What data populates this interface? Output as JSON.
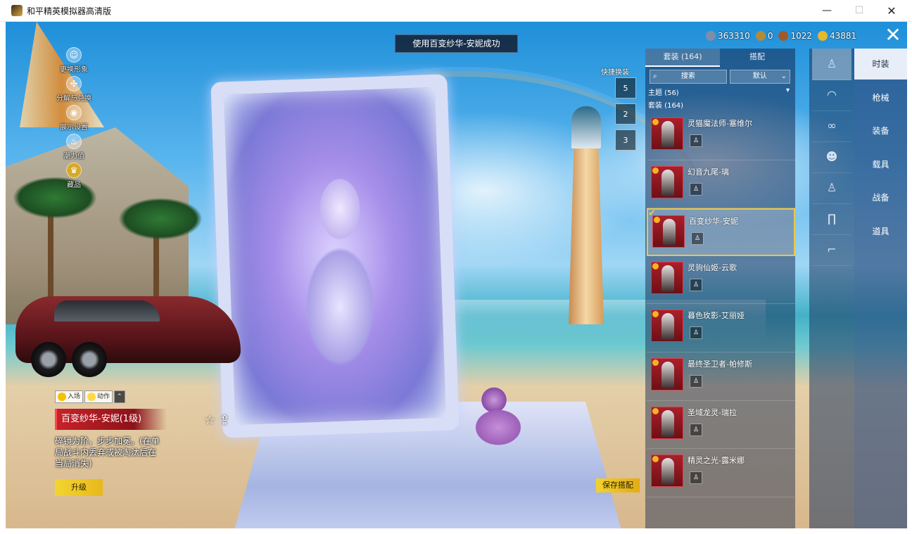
{
  "window": {
    "title": "和平精英模拟器高清版",
    "min_glyph": "—",
    "max_glyph": "☐",
    "close_glyph": "✕"
  },
  "toast": "使用百变纱华-安妮成功",
  "currencies": [
    {
      "icon": "gem-icon",
      "value": "363310",
      "color": "#7f8ea8"
    },
    {
      "icon": "coin-icon",
      "value": "0",
      "color": "#b08b3a"
    },
    {
      "icon": "token-icon",
      "value": "1022",
      "color": "#a05a2a"
    },
    {
      "icon": "gold-coin-icon",
      "value": "43881",
      "color": "#e6b82a"
    }
  ],
  "left_menu": [
    {
      "label": "更换形象",
      "icon": "person-icon",
      "glyph": "☺"
    },
    {
      "label": "分解与兑换",
      "icon": "swap-icon",
      "glyph": "✣"
    },
    {
      "label": "展示设置",
      "icon": "eye-icon",
      "glyph": "◉"
    },
    {
      "label": "潮力值",
      "icon": "flame-icon",
      "glyph": "♨"
    },
    {
      "label": "藏品",
      "icon": "crown-icon",
      "glyph": "♛"
    }
  ],
  "quick_swap": {
    "label": "快捷换装",
    "slots": [
      "5",
      "2",
      "3"
    ]
  },
  "panel": {
    "tabs": [
      "套装 (164)",
      "搭配"
    ],
    "search_placeholder": "搜索",
    "sort_label": "默认",
    "theme_label": "主题 (56)",
    "set_label": "套装 (164)",
    "items": [
      {
        "name": "灵猫魔法师-塞维尔",
        "selected": false
      },
      {
        "name": "幻音九尾-璃",
        "selected": false
      },
      {
        "name": "百变纱华-安妮",
        "selected": true
      },
      {
        "name": "灵驹仙姬-云歌",
        "selected": false
      },
      {
        "name": "暮色玫影-艾丽娅",
        "selected": false
      },
      {
        "name": "最终圣卫者-帕修斯",
        "selected": false
      },
      {
        "name": "圣域龙灵-瑞拉",
        "selected": false
      },
      {
        "name": "精灵之光-露米娜",
        "selected": false
      }
    ]
  },
  "category_icons": [
    {
      "icon": "outfit-icon",
      "glyph": "♙",
      "active": true
    },
    {
      "icon": "hat-icon",
      "glyph": "◠",
      "active": false
    },
    {
      "icon": "glasses-icon",
      "glyph": "∞",
      "active": false
    },
    {
      "icon": "face-icon",
      "glyph": "☻",
      "active": false
    },
    {
      "icon": "top-icon",
      "glyph": "♙",
      "active": false
    },
    {
      "icon": "pants-icon",
      "glyph": "∏",
      "active": false
    },
    {
      "icon": "shoes-icon",
      "glyph": "⌐",
      "active": false
    }
  ],
  "category_tabs": [
    {
      "label": "时装",
      "active": true
    },
    {
      "label": "枪械",
      "active": false
    },
    {
      "label": "装备",
      "active": false
    },
    {
      "label": "载具",
      "active": false
    },
    {
      "label": "战备",
      "active": false
    },
    {
      "label": "道具",
      "active": false
    }
  ],
  "bottom_left": {
    "entrance_label": "入场",
    "action_label": "动作",
    "item_name": "百变纱华-安妮(1级)",
    "description": "碎镜为阶，步步加冕。(在单局战斗内丢弃或被淘汰后在当局消失)",
    "upgrade_label": "升级"
  },
  "save_label": "保存搭配",
  "colors": {
    "accent_gold": "#e9c84a",
    "accent_red": "#c7222a"
  }
}
